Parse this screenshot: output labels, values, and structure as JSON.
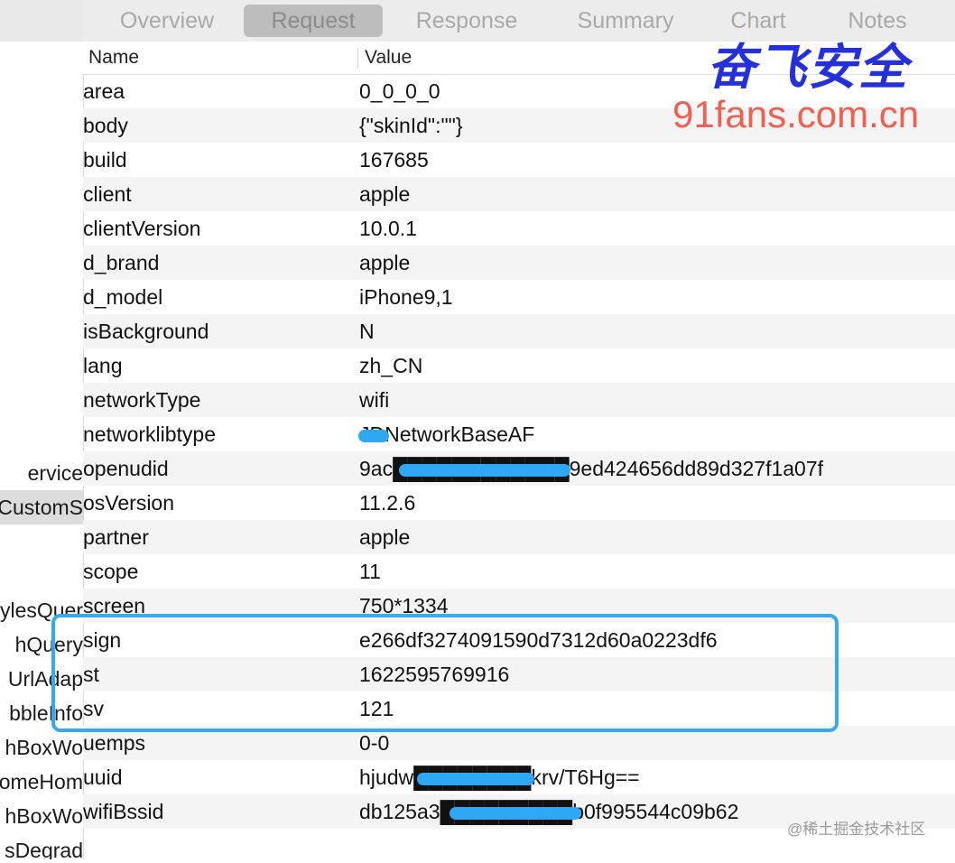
{
  "tabs": [
    "Overview",
    "Request",
    "Response",
    "Summary",
    "Chart",
    "Notes"
  ],
  "active_tab": "Request",
  "table": {
    "headers": {
      "name": "Name",
      "value": "Value"
    },
    "rows": [
      {
        "key": "area",
        "value": "0_0_0_0"
      },
      {
        "key": "body",
        "value": "{\"skinId\":\"\"}"
      },
      {
        "key": "build",
        "value": "167685"
      },
      {
        "key": "client",
        "value": "apple"
      },
      {
        "key": "clientVersion",
        "value": "10.0.1"
      },
      {
        "key": "d_brand",
        "value": "apple"
      },
      {
        "key": "d_model",
        "value": "iPhone9,1"
      },
      {
        "key": "isBackground",
        "value": "N"
      },
      {
        "key": "lang",
        "value": "zh_CN"
      },
      {
        "key": "networkType",
        "value": "wifi"
      },
      {
        "key": "networklibtype",
        "value": "JDNetworkBaseAF"
      },
      {
        "key": "openudid",
        "value": "9ac████████████9ed424656dd89d327f1a07f"
      },
      {
        "key": "osVersion",
        "value": "11.2.6"
      },
      {
        "key": "partner",
        "value": "apple"
      },
      {
        "key": "scope",
        "value": "11"
      },
      {
        "key": "screen",
        "value": "750*1334"
      },
      {
        "key": "sign",
        "value": "e266df3274091590d7312d60a0223df6"
      },
      {
        "key": "st",
        "value": "1622595769916"
      },
      {
        "key": "sv",
        "value": "121"
      },
      {
        "key": "uemps",
        "value": "0-0"
      },
      {
        "key": "uuid",
        "value": "hjudw████████krv/T6Hg=="
      },
      {
        "key": "wifiBssid",
        "value": "db125a3█████████b0f995544c09b62"
      },
      {
        "key": "",
        "value": ""
      }
    ]
  },
  "sidebar": {
    "items": [
      {
        "label": "ervice",
        "selected": false
      },
      {
        "label": "CustomS",
        "selected": true
      },
      {
        "label": "ylesQuer",
        "selected": false
      },
      {
        "label": "hQuery",
        "selected": false
      },
      {
        "label": "UrlAdap",
        "selected": false
      },
      {
        "label": "bbleInfo",
        "selected": false
      },
      {
        "label": "hBoxWo",
        "selected": false
      },
      {
        "label": "omeHom",
        "selected": false
      },
      {
        "label": "hBoxWo",
        "selected": false
      },
      {
        "label": "sDegrad",
        "selected": false
      }
    ]
  },
  "watermarks": {
    "brand_cn": "奋飞安全",
    "brand_url": "91fans.com.cn",
    "footer": "@稀土掘金技术社区"
  },
  "colors": {
    "highlight": "#3aa9ec",
    "redaction": "#2fa8f4",
    "brand_cn": "#2530d8",
    "brand_url": "#f06050"
  }
}
